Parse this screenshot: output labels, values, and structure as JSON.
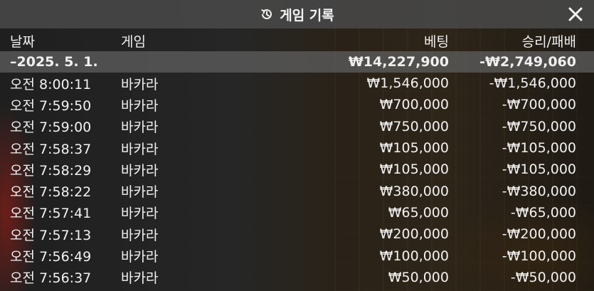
{
  "dialog": {
    "title": "게임 기록",
    "title_icon": "history-icon",
    "close_icon": "close-icon"
  },
  "table": {
    "headers": {
      "date": "날짜",
      "game": "게임",
      "bet": "베팅",
      "result": "승리/패배"
    },
    "date_group": {
      "date": "–2025. 5. 1.",
      "bet_total": "₩14,227,900",
      "result_total": "-₩2,749,060"
    },
    "rows": [
      {
        "time": "오전 8:00:11",
        "game": "바카라",
        "bet": "₩1,546,000",
        "result": "-₩1,546,000"
      },
      {
        "time": "오전 7:59:50",
        "game": "바카라",
        "bet": "₩700,000",
        "result": "-₩700,000"
      },
      {
        "time": "오전 7:59:00",
        "game": "바카라",
        "bet": "₩750,000",
        "result": "-₩750,000"
      },
      {
        "time": "오전 7:58:37",
        "game": "바카라",
        "bet": "₩105,000",
        "result": "-₩105,000"
      },
      {
        "time": "오전 7:58:29",
        "game": "바카라",
        "bet": "₩105,000",
        "result": "-₩105,000"
      },
      {
        "time": "오전 7:58:22",
        "game": "바카라",
        "bet": "₩380,000",
        "result": "-₩380,000"
      },
      {
        "time": "오전 7:57:41",
        "game": "바카라",
        "bet": "₩65,000",
        "result": "-₩65,000"
      },
      {
        "time": "오전 7:57:13",
        "game": "바카라",
        "bet": "₩200,000",
        "result": "-₩200,000"
      },
      {
        "time": "오전 7:56:49",
        "game": "바카라",
        "bet": "₩100,000",
        "result": "-₩100,000"
      },
      {
        "time": "오전 7:56:37",
        "game": "바카라",
        "bet": "₩50,000",
        "result": "-₩50,000"
      }
    ]
  }
}
